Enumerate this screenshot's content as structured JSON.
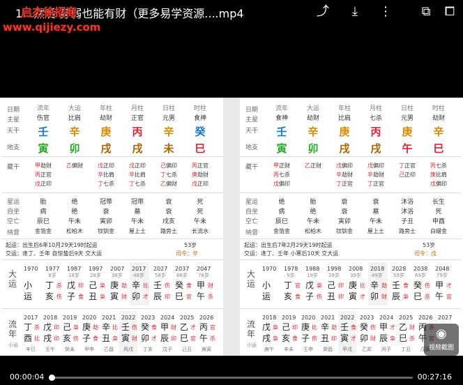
{
  "header": {
    "title": "1…然后 身弱也能有财（更多易学资源....mp4",
    "watermark_top": "启杰徐招商",
    "watermark_url": "www.qijiezy.com"
  },
  "icons": {
    "share": "share-icon",
    "download": "download-icon",
    "more": "more-icon",
    "pip": "pip-icon",
    "cast": "cast-icon"
  },
  "player": {
    "current": "00:00:04",
    "total": "00:27:16",
    "progress": 0.003,
    "screenshot_label": "视频截图"
  },
  "left": {
    "labels": {
      "rq": "日期",
      "zx": "主星",
      "tg": "天干",
      "dz": "地支",
      "cg": "藏干",
      "xy": "星运",
      "zz": "自坐",
      "kw": "空亡",
      "ny": "纳音"
    },
    "cols": [
      {
        "h": "流年",
        "zx": "伤官",
        "tg": "壬",
        "tgc": "blue",
        "dz": "寅",
        "dzc": "green",
        "cg": [
          "甲",
          "丙",
          "戊"
        ],
        "cgs": [
          "劫财",
          "正官",
          "正印"
        ],
        "xy": "胎",
        "zz": "病",
        "kw": "辰巳",
        "ny": "金箔金"
      },
      {
        "h": "大运",
        "zx": "比肩",
        "tg": "辛",
        "tgc": "org",
        "dz": "卯",
        "dzc": "green",
        "cg": [
          "乙"
        ],
        "cgs": [
          "偏财"
        ],
        "xy": "绝",
        "zz": "绝",
        "kw": "午未",
        "ny": "松柏木"
      },
      {
        "h": "年柱",
        "zx": "劫财",
        "tg": "庚",
        "tgc": "org",
        "dz": "戌",
        "dzc": "brown",
        "cg": [
          "戊",
          "辛",
          "丁"
        ],
        "cgs": [
          "正印",
          "比肩",
          "七杀"
        ],
        "xy": "冠带",
        "zz": "衰",
        "kw": "寅卯",
        "ny": "钗钏金"
      },
      {
        "h": "月柱",
        "zx": "正官",
        "tg": "丙",
        "tgc": "red",
        "dz": "戌",
        "dzc": "brown",
        "cg": [
          "戊",
          "辛",
          "丁"
        ],
        "cgs": [
          "正印",
          "比肩",
          "七杀"
        ],
        "xy": "冠带",
        "zz": "墓",
        "kw": "午未",
        "ny": "屋上土"
      },
      {
        "h": "日柱",
        "zx": "元男",
        "tg": "辛",
        "tgc": "org",
        "dz": "未",
        "dzc": "brown",
        "cg": [
          "己",
          "丁",
          "乙"
        ],
        "cgs": [
          "偏印",
          "七杀",
          "偏财"
        ],
        "xy": "衰",
        "zz": "衰",
        "kw": "戌亥",
        "ny": "路旁土"
      },
      {
        "h": "时柱",
        "zx": "食神",
        "tg": "癸",
        "tgc": "blue",
        "dz": "巳",
        "dzc": "red",
        "cg": [
          "丙",
          "庚",
          "戊"
        ],
        "cgs": [
          "正官",
          "劫财",
          "正印"
        ],
        "xy": "死",
        "zz": "死",
        "kw": "午未",
        "ny": "长流水"
      }
    ],
    "qiyun": "起运：出生后6年10月29天19时起运",
    "jiaoyun": "交运：逢丁、壬年 自惊蛰后9天 交大运",
    "age": "53岁",
    "siling": "司令：辛",
    "dayun_label": "大运",
    "dayun": [
      {
        "y": "1970",
        "a": "",
        "g": "小",
        "z": "运",
        "gs": "",
        "zs": ""
      },
      {
        "y": "1977",
        "a": "8岁",
        "g": "丁",
        "z": "亥",
        "gs": "杀",
        "zs": "伤"
      },
      {
        "y": "1987",
        "a": "18岁",
        "g": "戊",
        "z": "子",
        "gs": "印",
        "zs": "食"
      },
      {
        "y": "1997",
        "a": "28岁",
        "g": "己",
        "z": "丑",
        "gs": "枭",
        "zs": "枭"
      },
      {
        "y": "2007",
        "a": "38岁",
        "g": "庚",
        "z": "寅",
        "gs": "劫",
        "zs": "财"
      },
      {
        "y": "2017",
        "a": "48岁",
        "g": "辛",
        "z": "卯",
        "gs": "比",
        "zs": "才"
      },
      {
        "y": "2027",
        "a": "58岁",
        "g": "壬",
        "z": "辰",
        "gs": "伤",
        "zs": "印"
      },
      {
        "y": "2037",
        "a": "68岁",
        "g": "癸",
        "z": "巳",
        "gs": "食",
        "zs": "官"
      },
      {
        "y": "2047",
        "a": "78岁",
        "g": "甲",
        "z": "午",
        "gs": "财",
        "zs": "杀"
      }
    ],
    "liunian_label": "流年",
    "liunian_sub": "小运",
    "liunian": [
      {
        "y": "2017",
        "g": "丁",
        "z": "酉",
        "gs": "杀",
        "zs": "比",
        "x": "辛巳"
      },
      {
        "y": "2018",
        "g": "戊",
        "z": "戌",
        "gs": "印",
        "zs": "印",
        "x": "壬午"
      },
      {
        "y": "2019",
        "g": "己",
        "z": "亥",
        "gs": "枭",
        "zs": "伤",
        "x": "癸未"
      },
      {
        "y": "2020",
        "g": "庚",
        "z": "子",
        "gs": "劫",
        "zs": "食",
        "x": "甲申"
      },
      {
        "y": "2021",
        "g": "辛",
        "z": "丑",
        "gs": "比",
        "zs": "枭",
        "x": "乙酉"
      },
      {
        "y": "2022",
        "g": "壬",
        "z": "寅",
        "gs": "伤",
        "zs": "财",
        "x": "丙戌"
      },
      {
        "y": "2023",
        "g": "癸",
        "z": "卯",
        "gs": "食",
        "zs": "才",
        "x": "丁亥"
      },
      {
        "y": "2024",
        "g": "甲",
        "z": "辰",
        "gs": "财",
        "zs": "印",
        "x": "戊子"
      },
      {
        "y": "2025",
        "g": "乙",
        "z": "巳",
        "gs": "才",
        "zs": "官",
        "x": "己丑"
      },
      {
        "y": "2026",
        "g": "丙",
        "z": "午",
        "gs": "官",
        "zs": "杀",
        "x": "庚寅"
      }
    ]
  },
  "right": {
    "cols": [
      {
        "h": "流年",
        "zx": "食神",
        "tg": "壬",
        "tgc": "blue",
        "dz": "寅",
        "dzc": "green",
        "cg": [
          "甲",
          "丙",
          "戊"
        ],
        "cgs": [
          "正财",
          "七杀",
          "偏印"
        ],
        "xy": "绝",
        "zz": "病",
        "kw": "辰巳",
        "ny": "金箔金"
      },
      {
        "h": "大运",
        "zx": "劫财",
        "tg": "辛",
        "tgc": "org",
        "dz": "卯",
        "dzc": "green",
        "cg": [
          "乙"
        ],
        "cgs": [
          "正财"
        ],
        "xy": "胎",
        "zz": "绝",
        "kw": "午未",
        "ny": "松柏木"
      },
      {
        "h": "年柱",
        "zx": "比肩",
        "tg": "庚",
        "tgc": "org",
        "dz": "戌",
        "dzc": "brown",
        "cg": [
          "戊",
          "辛",
          "丁"
        ],
        "cgs": [
          "偏印",
          "劫财",
          "正官"
        ],
        "xy": "衰",
        "zz": "衰",
        "kw": "寅卯",
        "ny": "钗钏金"
      },
      {
        "h": "月柱",
        "zx": "七杀",
        "tg": "丙",
        "tgc": "red",
        "dz": "戌",
        "dzc": "brown",
        "cg": [
          "戊",
          "辛",
          "丁"
        ],
        "cgs": [
          "偏印",
          "劫财",
          "正官"
        ],
        "xy": "衰",
        "zz": "墓",
        "kw": "午未",
        "ny": "屋上土"
      },
      {
        "h": "日柱",
        "zx": "元男",
        "tg": "庚",
        "tgc": "org",
        "dz": "午",
        "dzc": "red",
        "cg": [
          "丁",
          "己"
        ],
        "cgs": [
          "正官",
          "正印"
        ],
        "xy": "沐浴",
        "zz": "沐浴",
        "kw": "子丑",
        "ny": "路旁土"
      },
      {
        "h": "时柱",
        "zx": "劫财",
        "tg": "辛",
        "tgc": "org",
        "dz": "巳",
        "dzc": "red",
        "cg": [
          "丙",
          "庚",
          "戊"
        ],
        "cgs": [
          "七杀",
          "比肩",
          "偏印"
        ],
        "xy": "长生",
        "zz": "死",
        "kw": "申酉",
        "ny": "白蜡金"
      }
    ],
    "qiyun": "起运：出生后7年2月29天19时起运",
    "jiaoyun": "交运：逢丁、壬年 小寒后10天 交大运",
    "age": "53岁",
    "siling": "司令：戊",
    "dayun": [
      {
        "y": "1970",
        "a": "",
        "g": "小",
        "z": "运",
        "gs": "",
        "zs": ""
      },
      {
        "y": "1978",
        "a": "9岁",
        "g": "丁",
        "z": "亥",
        "gs": "官",
        "zs": "食"
      },
      {
        "y": "1988",
        "a": "19岁",
        "g": "戊",
        "z": "子",
        "gs": "枭",
        "zs": "伤"
      },
      {
        "y": "1998",
        "a": "29岁",
        "g": "己",
        "z": "丑",
        "gs": "印",
        "zs": "印"
      },
      {
        "y": "2008",
        "a": "39岁",
        "g": "庚",
        "z": "寅",
        "gs": "比",
        "zs": "才"
      },
      {
        "y": "2018",
        "a": "49岁",
        "g": "辛",
        "z": "卯",
        "gs": "劫",
        "zs": "财"
      },
      {
        "y": "2028",
        "a": "59岁",
        "g": "壬",
        "z": "辰",
        "gs": "食",
        "zs": "枭"
      },
      {
        "y": "2038",
        "a": "69岁",
        "g": "癸",
        "z": "巳",
        "gs": "伤",
        "zs": "杀"
      },
      {
        "y": "2048",
        "a": "79岁",
        "g": "甲",
        "z": "午",
        "gs": "才",
        "zs": "官"
      }
    ],
    "liunian": [
      {
        "y": "2018",
        "g": "戊",
        "z": "戌",
        "gs": "枭",
        "zs": "枭",
        "x": "庚午"
      },
      {
        "y": "2019",
        "g": "己",
        "z": "亥",
        "gs": "印",
        "zs": "食",
        "x": "辛未"
      },
      {
        "y": "2020",
        "g": "庚",
        "z": "子",
        "gs": "比",
        "zs": "伤",
        "x": "壬申"
      },
      {
        "y": "2021",
        "g": "辛",
        "z": "丑",
        "gs": "劫",
        "zs": "印",
        "x": "癸酉"
      },
      {
        "y": "2022",
        "g": "壬",
        "z": "寅",
        "gs": "食",
        "zs": "才",
        "x": "甲戌"
      },
      {
        "y": "2023",
        "g": "癸",
        "z": "卯",
        "gs": "伤",
        "zs": "财",
        "x": "乙亥"
      },
      {
        "y": "2024",
        "g": "甲",
        "z": "辰",
        "gs": "才",
        "zs": "枭",
        "x": "丙子"
      },
      {
        "y": "2025",
        "g": "乙",
        "z": "巳",
        "gs": "财",
        "zs": "杀",
        "x": "丁丑"
      },
      {
        "y": "2026",
        "g": "丙",
        "z": "午",
        "gs": "杀",
        "zs": "官",
        "x": "戊寅"
      },
      {
        "y": "2027",
        "g": "",
        "z": "",
        "gs": "",
        "zs": "",
        "x": ""
      }
    ]
  }
}
